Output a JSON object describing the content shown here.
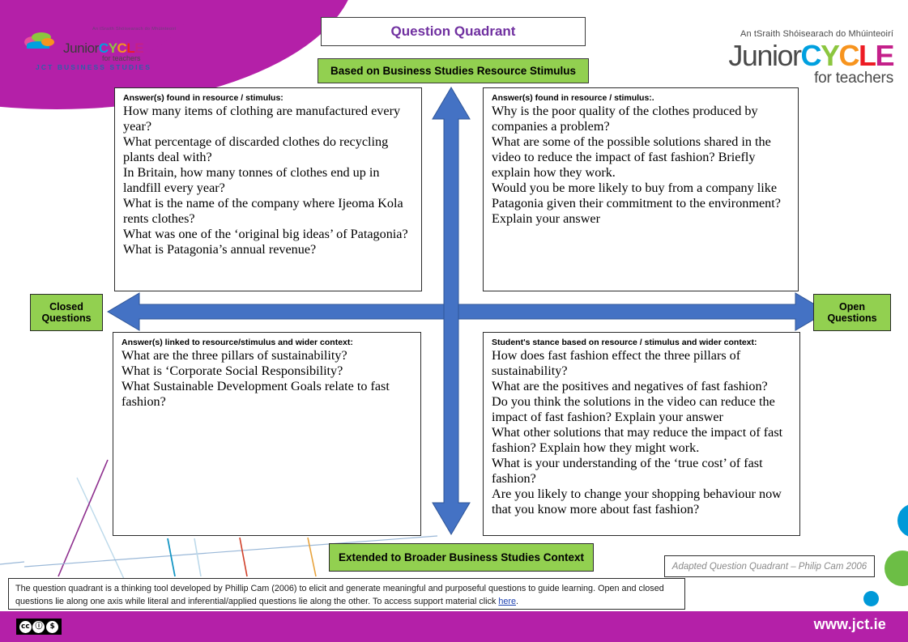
{
  "header": {
    "title": "Question Quadrant",
    "subtitle": "Based on Business Studies Resource Stimulus",
    "title_color": "#7030A0",
    "banner_color": "#92D050"
  },
  "brand_left": {
    "gaeilge": "An tSraith Shóisearach do Mhúinteoirí",
    "junior": "Junior",
    "cycle": "CYCLE",
    "for_teachers": "for teachers",
    "subject": "JCT BUSINESS STUDIES"
  },
  "brand_right": {
    "gaeilge": "An tSraith Shóisearach do Mhúinteoirí",
    "junior": "Junior",
    "c1": "C",
    "y": "Y",
    "c2": "C",
    "l": "L",
    "e": "E",
    "for_teachers": "for teachers"
  },
  "axis": {
    "left_label": "Closed\nQuestions",
    "left_label_line1": "Closed",
    "left_label_line2": "Questions",
    "right_label_line1": "Open",
    "right_label_line2": "Questions",
    "arrow_color": "#4472C4"
  },
  "quadrants": {
    "top_left": {
      "heading": "Answer(s) found in resource / stimulus:",
      "items": [
        "How many items of clothing are manufactured every year?",
        "What percentage of discarded clothes do recycling plants deal with?",
        "In Britain, how many tonnes of clothes end up in landfill every year?",
        "What is the name of the company where Ijeoma Kola rents clothes?",
        "What was one of the ‘original big ideas’ of Patagonia?",
        "What is Patagonia’s annual revenue?"
      ]
    },
    "top_right": {
      "heading": "Answer(s) found in resource / stimulus:.",
      "items": [
        "Why is the poor quality of the clothes produced by companies a problem?",
        "What are some of the possible solutions shared in the video to reduce the impact of fast fashion? Briefly explain how they work.",
        "Would you be more likely to buy from a company like Patagonia given their commitment to the environment? Explain your answer"
      ]
    },
    "bottom_left": {
      "heading": "Answer(s) linked to resource/stimulus and wider context:",
      "items": [
        "What are the three pillars of sustainability?",
        "What is ‘Corporate Social Responsibility?",
        "What Sustainable Development Goals relate to fast fashion?"
      ]
    },
    "bottom_right": {
      "heading": "Student's stance based on resource / stimulus and wider context:",
      "items": [
        "How does fast fashion effect the three pillars of sustainability?",
        "What are the positives and negatives of fast fashion?",
        "Do you think the solutions in the video can reduce the impact of fast fashion? Explain your answer",
        "What other solutions that may reduce the impact of fast fashion? Explain how they might work.",
        "What is your understanding of the ‘true cost’ of fast fashion?",
        "Are you likely to change your shopping behaviour now that you know more about fast fashion?"
      ]
    }
  },
  "bottom": {
    "banner": "Extended to Broader Business Studies Context",
    "credit": "Adapted Question Quadrant – Philip Cam 2006",
    "note_part1": "The question quadrant is a thinking tool developed by Phillip Cam (2006) to elicit and generate meaningful and purposeful questions to guide learning. Open and closed questions lie along one axis while literal and inferential/applied questions lie along the other.   To access support material click ",
    "note_link": "here",
    "note_part2": "."
  },
  "footer": {
    "url": "www.jct.ie",
    "bar_color": "#B420A8",
    "license": "CC BY-NC",
    "cc_mark": "cc",
    "cc_by": "BY",
    "cc_nc": "NC"
  },
  "decor": {
    "circle_blue_big": "#0099D8",
    "circle_green": "#6CBE45",
    "circle_blue_small": "#0099D8"
  }
}
